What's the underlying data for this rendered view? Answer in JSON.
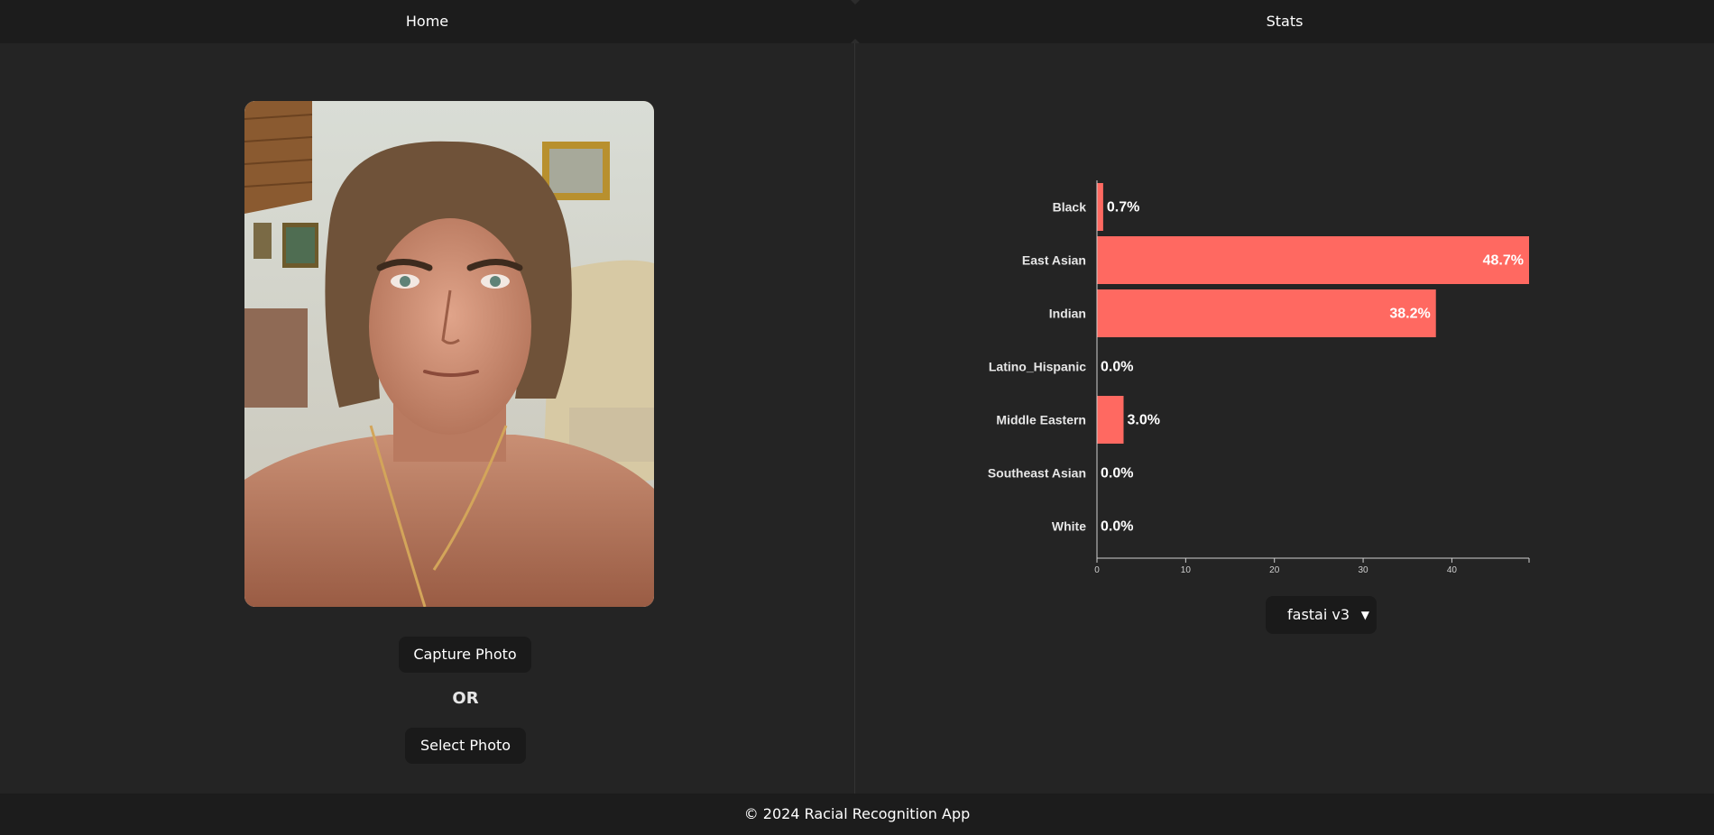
{
  "nav": {
    "home_label": "Home",
    "stats_label": "Stats"
  },
  "capture": {
    "capture_label": "Capture Photo",
    "or_label": "OR",
    "select_label": "Select Photo"
  },
  "model": {
    "selected": "fastai v3"
  },
  "footer": {
    "text": "© 2024 Racial Recognition App"
  },
  "colors": {
    "bar": "#ff6961",
    "background": "#242424",
    "bar_label_outside": "#ffffff",
    "bar_label_inside": "#ffffff"
  },
  "chart_data": {
    "type": "bar",
    "orientation": "horizontal",
    "categories": [
      "Black",
      "East Asian",
      "Indian",
      "Latino_Hispanic",
      "Middle Eastern",
      "Southeast Asian",
      "White"
    ],
    "values": [
      0.7,
      48.7,
      38.2,
      0.0,
      3.0,
      0.0,
      0.0
    ],
    "value_labels": [
      "0.7%",
      "48.7%",
      "38.2%",
      "0.0%",
      "3.0%",
      "0.0%",
      "0.0%"
    ],
    "x_ticks": [
      0,
      10,
      20,
      30,
      40
    ],
    "xlim": [
      0,
      48.7
    ],
    "grid": false
  }
}
